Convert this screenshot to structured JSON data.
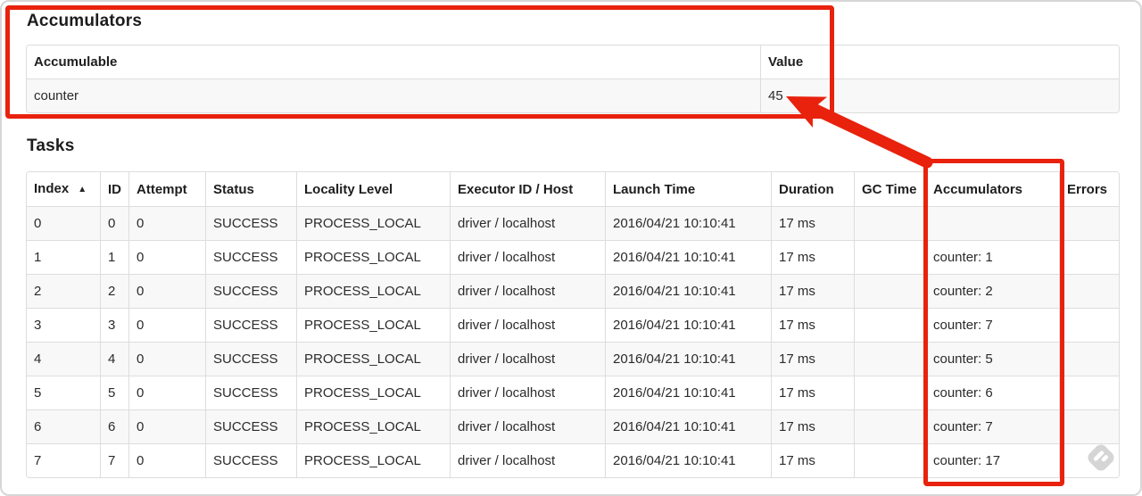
{
  "accumulators_section": {
    "title": "Accumulators",
    "table": {
      "headers": [
        "Accumulable",
        "Value"
      ],
      "rows": [
        [
          "counter",
          "45"
        ]
      ]
    }
  },
  "tasks_section": {
    "title": "Tasks",
    "table": {
      "headers": [
        "Index",
        "ID",
        "Attempt",
        "Status",
        "Locality Level",
        "Executor ID / Host",
        "Launch Time",
        "Duration",
        "GC Time",
        "Accumulators",
        "Errors"
      ],
      "sorted_column": "Index",
      "sort_ascending_icon": "▲",
      "rows": [
        [
          "0",
          "0",
          "0",
          "SUCCESS",
          "PROCESS_LOCAL",
          "driver / localhost",
          "2016/04/21 10:10:41",
          "17 ms",
          "",
          "",
          ""
        ],
        [
          "1",
          "1",
          "0",
          "SUCCESS",
          "PROCESS_LOCAL",
          "driver / localhost",
          "2016/04/21 10:10:41",
          "17 ms",
          "",
          "counter: 1",
          ""
        ],
        [
          "2",
          "2",
          "0",
          "SUCCESS",
          "PROCESS_LOCAL",
          "driver / localhost",
          "2016/04/21 10:10:41",
          "17 ms",
          "",
          "counter: 2",
          ""
        ],
        [
          "3",
          "3",
          "0",
          "SUCCESS",
          "PROCESS_LOCAL",
          "driver / localhost",
          "2016/04/21 10:10:41",
          "17 ms",
          "",
          "counter: 7",
          ""
        ],
        [
          "4",
          "4",
          "0",
          "SUCCESS",
          "PROCESS_LOCAL",
          "driver / localhost",
          "2016/04/21 10:10:41",
          "17 ms",
          "",
          "counter: 5",
          ""
        ],
        [
          "5",
          "5",
          "0",
          "SUCCESS",
          "PROCESS_LOCAL",
          "driver / localhost",
          "2016/04/21 10:10:41",
          "17 ms",
          "",
          "counter: 6",
          ""
        ],
        [
          "6",
          "6",
          "0",
          "SUCCESS",
          "PROCESS_LOCAL",
          "driver / localhost",
          "2016/04/21 10:10:41",
          "17 ms",
          "",
          "counter: 7",
          ""
        ],
        [
          "7",
          "7",
          "0",
          "SUCCESS",
          "PROCESS_LOCAL",
          "driver / localhost",
          "2016/04/21 10:10:41",
          "17 ms",
          "",
          "counter: 17",
          ""
        ]
      ]
    }
  },
  "annotations": {
    "color": "#e8220d",
    "boxes": [
      "accumulators-summary",
      "accumulators-column"
    ],
    "arrow": "accumulators-column-to-total-value"
  },
  "watermark": {
    "icon": "feedly-icon"
  }
}
